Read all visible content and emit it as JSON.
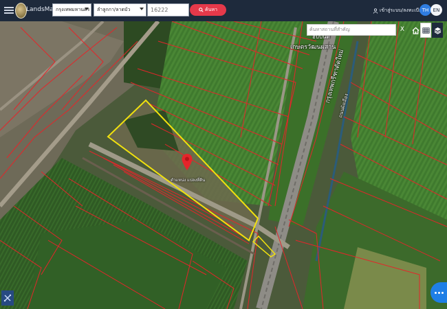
{
  "header": {
    "brand": "LandsMaps",
    "province": "กรุงเทพมหานคร",
    "district": "ลำลูกกา/ลาดบัว",
    "code_value": "16222",
    "search_label": "ค้นหา",
    "login_label": "เข้าสู่ระบบ/ลงทะเบียน",
    "lang_th": "TH",
    "lang_en": "EN"
  },
  "map_controls": {
    "place_search_placeholder": "ค้นหาสถานที่สำคัญ",
    "close_label": "X"
  },
  "map_labels": {
    "place_line1": "ฮับบิ้นดี",
    "place_line2": "เกษตรวัฒนผสาน",
    "road_line1": "กรุงเทพกรีฑาตัดใหม่",
    "road_line2": "ถนนผังเมือง",
    "parcel_label": "ตำแหน่ง แปลงที่ดิน"
  },
  "colors": {
    "topbar": "#1e2a3c",
    "search_button": "#e5394a",
    "lang_active": "#2f7de1",
    "parcel_outline": "#e4252a",
    "selected_parcel": "#f1e10e",
    "more_button": "#1f7fe6"
  },
  "icons": [
    "menu-icon",
    "logo-icon",
    "search-icon",
    "user-icon",
    "home-icon",
    "grid-icon",
    "layers-icon",
    "map-pin-icon",
    "measure-icon",
    "more-icon"
  ]
}
